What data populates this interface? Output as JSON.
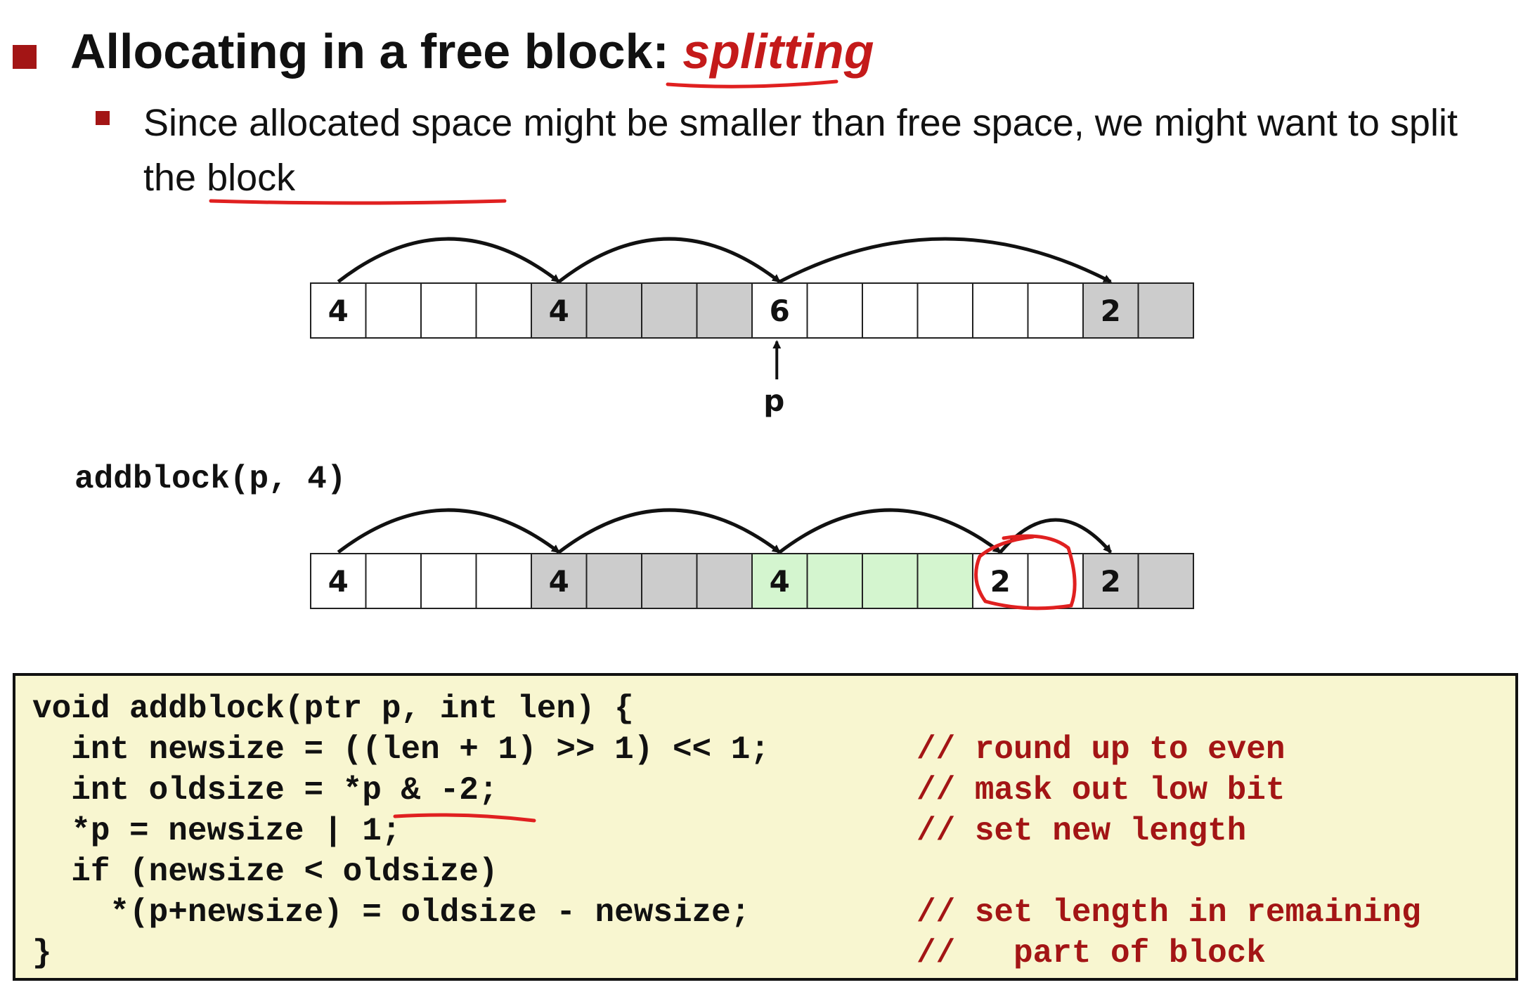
{
  "title": {
    "prefix": "Allocating in a free block: ",
    "emphasis": "splitting"
  },
  "subtext": "Since allocated space might be smaller than free space, we might want to split the block",
  "call_label": "addblock(p, 4)",
  "pointer_label": "p",
  "colors": {
    "bullet": "#a31515",
    "allocated": "#cccccc",
    "free": "#ffffff",
    "new_alloc": "#d4f5cf",
    "annotation": "#e02020",
    "code_bg": "#f8f6d0",
    "comment": "#a31515"
  },
  "before": {
    "cells": [
      {
        "label": "4",
        "state": "free"
      },
      {
        "label": "",
        "state": "free"
      },
      {
        "label": "",
        "state": "free"
      },
      {
        "label": "",
        "state": "free"
      },
      {
        "label": "4",
        "state": "allocated"
      },
      {
        "label": "",
        "state": "allocated"
      },
      {
        "label": "",
        "state": "allocated"
      },
      {
        "label": "",
        "state": "allocated"
      },
      {
        "label": "6",
        "state": "free"
      },
      {
        "label": "",
        "state": "free"
      },
      {
        "label": "",
        "state": "free"
      },
      {
        "label": "",
        "state": "free"
      },
      {
        "label": "",
        "state": "free"
      },
      {
        "label": "",
        "state": "free"
      },
      {
        "label": "2",
        "state": "allocated"
      },
      {
        "label": "",
        "state": "allocated"
      }
    ],
    "links": [
      [
        0,
        4
      ],
      [
        4,
        8
      ],
      [
        8,
        14
      ]
    ],
    "pointer_cell": 8
  },
  "after": {
    "cells": [
      {
        "label": "4",
        "state": "free"
      },
      {
        "label": "",
        "state": "free"
      },
      {
        "label": "",
        "state": "free"
      },
      {
        "label": "",
        "state": "free"
      },
      {
        "label": "4",
        "state": "allocated"
      },
      {
        "label": "",
        "state": "allocated"
      },
      {
        "label": "",
        "state": "allocated"
      },
      {
        "label": "",
        "state": "allocated"
      },
      {
        "label": "4",
        "state": "new_alloc"
      },
      {
        "label": "",
        "state": "new_alloc"
      },
      {
        "label": "",
        "state": "new_alloc"
      },
      {
        "label": "",
        "state": "new_alloc"
      },
      {
        "label": "2",
        "state": "free"
      },
      {
        "label": "",
        "state": "free"
      },
      {
        "label": "2",
        "state": "allocated"
      },
      {
        "label": "",
        "state": "allocated"
      }
    ],
    "links": [
      [
        0,
        4
      ],
      [
        4,
        8
      ],
      [
        8,
        12
      ],
      [
        12,
        14
      ]
    ]
  },
  "code": {
    "lines": [
      "void addblock(ptr p, int len) {",
      "  int newsize = ((len + 1) >> 1) << 1;",
      "  int oldsize = *p & -2;",
      "  *p = newsize | 1;",
      "  if (newsize < oldsize)",
      "    *(p+newsize) = oldsize - newsize;",
      "}"
    ],
    "comments": [
      "",
      "// round up to even",
      "// mask out low bit",
      "// set new length",
      "",
      "// set length in remaining",
      "//   part of block"
    ]
  }
}
